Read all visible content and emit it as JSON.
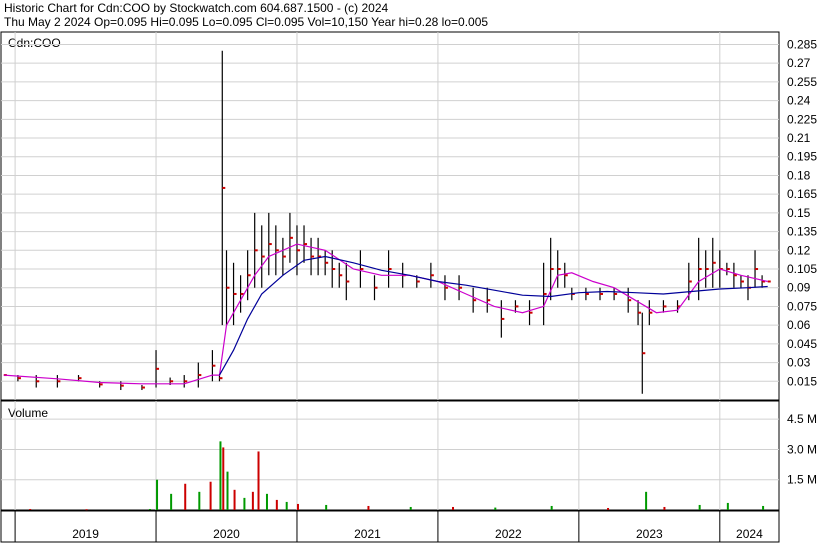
{
  "header": {
    "line1": "Historic Chart for Cdn:COO by Stockwatch.com 604.687.1500 - (c) 2024",
    "line2": "Thu May  2 2024   Op=0.095  Hi=0.095  Lo=0.095  Cl=0.095  Vol=10,150  Year hi=0.28  lo=0.005"
  },
  "chart_data": [
    {
      "type": "line",
      "subtype": "ohlc-bars",
      "label": "Cdn:COO",
      "y_ticks": [
        "0.285",
        "0.27",
        "0.255",
        "0.24",
        "0.225",
        "0.21",
        "0.195",
        "0.18",
        "0.165",
        "0.15",
        "0.135",
        "0.12",
        "0.105",
        "0.09",
        "0.075",
        "0.06",
        "0.045",
        "0.03",
        "0.015"
      ],
      "ylim": [
        0,
        0.295
      ],
      "xlim": [
        2018.9,
        2024.42
      ],
      "grid": true,
      "colors": {
        "price": "#000000",
        "close_tick": "#cc0000",
        "ma_short": "#cc00cc",
        "ma_long": "#000099"
      },
      "series": [
        {
          "kind": "price_range",
          "points": [
            [
              2018.92,
              0.02,
              0.02
            ],
            [
              2019.02,
              0.015,
              0.02
            ],
            [
              2019.15,
              0.01,
              0.02
            ],
            [
              2019.3,
              0.01,
              0.02
            ],
            [
              2019.45,
              0.015,
              0.02
            ],
            [
              2019.6,
              0.01,
              0.015
            ],
            [
              2019.75,
              0.008,
              0.015
            ],
            [
              2019.9,
              0.008,
              0.012
            ],
            [
              2020.0,
              0.01,
              0.04
            ],
            [
              2020.1,
              0.012,
              0.018
            ],
            [
              2020.2,
              0.01,
              0.02
            ],
            [
              2020.3,
              0.01,
              0.03
            ],
            [
              2020.4,
              0.015,
              0.04
            ],
            [
              2020.45,
              0.015,
              0.02
            ],
            [
              2020.47,
              0.06,
              0.28
            ],
            [
              2020.5,
              0.06,
              0.12
            ],
            [
              2020.55,
              0.06,
              0.11
            ],
            [
              2020.6,
              0.07,
              0.1
            ],
            [
              2020.65,
              0.08,
              0.12
            ],
            [
              2020.7,
              0.09,
              0.15
            ],
            [
              2020.75,
              0.09,
              0.14
            ],
            [
              2020.8,
              0.1,
              0.15
            ],
            [
              2020.85,
              0.1,
              0.14
            ],
            [
              2020.9,
              0.1,
              0.13
            ],
            [
              2020.95,
              0.11,
              0.15
            ],
            [
              2021.0,
              0.1,
              0.14
            ],
            [
              2021.05,
              0.11,
              0.14
            ],
            [
              2021.1,
              0.1,
              0.13
            ],
            [
              2021.15,
              0.1,
              0.13
            ],
            [
              2021.2,
              0.1,
              0.12
            ],
            [
              2021.25,
              0.09,
              0.12
            ],
            [
              2021.3,
              0.09,
              0.11
            ],
            [
              2021.35,
              0.08,
              0.11
            ],
            [
              2021.45,
              0.09,
              0.12
            ],
            [
              2021.55,
              0.08,
              0.1
            ],
            [
              2021.65,
              0.09,
              0.12
            ],
            [
              2021.75,
              0.09,
              0.11
            ],
            [
              2021.85,
              0.09,
              0.1
            ],
            [
              2021.95,
              0.09,
              0.11
            ],
            [
              2022.05,
              0.08,
              0.1
            ],
            [
              2022.15,
              0.08,
              0.1
            ],
            [
              2022.25,
              0.07,
              0.09
            ],
            [
              2022.35,
              0.07,
              0.09
            ],
            [
              2022.45,
              0.05,
              0.08
            ],
            [
              2022.55,
              0.07,
              0.08
            ],
            [
              2022.65,
              0.06,
              0.08
            ],
            [
              2022.75,
              0.06,
              0.11
            ],
            [
              2022.8,
              0.08,
              0.13
            ],
            [
              2022.85,
              0.09,
              0.12
            ],
            [
              2022.9,
              0.09,
              0.11
            ],
            [
              2022.95,
              0.08,
              0.09
            ],
            [
              2023.05,
              0.08,
              0.09
            ],
            [
              2023.15,
              0.08,
              0.09
            ],
            [
              2023.25,
              0.08,
              0.09
            ],
            [
              2023.35,
              0.07,
              0.09
            ],
            [
              2023.42,
              0.06,
              0.08
            ],
            [
              2023.45,
              0.005,
              0.07
            ],
            [
              2023.5,
              0.06,
              0.08
            ],
            [
              2023.6,
              0.07,
              0.08
            ],
            [
              2023.7,
              0.07,
              0.08
            ],
            [
              2023.78,
              0.08,
              0.11
            ],
            [
              2023.85,
              0.08,
              0.13
            ],
            [
              2023.9,
              0.09,
              0.12
            ],
            [
              2023.95,
              0.09,
              0.13
            ],
            [
              2024.0,
              0.09,
              0.12
            ],
            [
              2024.05,
              0.1,
              0.11
            ],
            [
              2024.1,
              0.09,
              0.11
            ],
            [
              2024.15,
              0.09,
              0.1
            ],
            [
              2024.2,
              0.08,
              0.1
            ],
            [
              2024.25,
              0.09,
              0.12
            ],
            [
              2024.3,
              0.09,
              0.1
            ],
            [
              2024.34,
              0.095,
              0.095
            ]
          ]
        },
        {
          "name": "",
          "kind": "moving_average_short",
          "points": [
            [
              2018.92,
              0.02
            ],
            [
              2019.3,
              0.017
            ],
            [
              2019.6,
              0.014
            ],
            [
              2019.9,
              0.013
            ],
            [
              2020.2,
              0.013
            ],
            [
              2020.4,
              0.02
            ],
            [
              2020.45,
              0.02
            ],
            [
              2020.5,
              0.06
            ],
            [
              2020.6,
              0.08
            ],
            [
              2020.7,
              0.1
            ],
            [
              2020.8,
              0.115
            ],
            [
              2021.0,
              0.125
            ],
            [
              2021.2,
              0.12
            ],
            [
              2021.4,
              0.105
            ],
            [
              2021.6,
              0.1
            ],
            [
              2021.8,
              0.1
            ],
            [
              2022.0,
              0.095
            ],
            [
              2022.2,
              0.085
            ],
            [
              2022.4,
              0.075
            ],
            [
              2022.6,
              0.07
            ],
            [
              2022.75,
              0.075
            ],
            [
              2022.85,
              0.1
            ],
            [
              2022.95,
              0.102
            ],
            [
              2023.1,
              0.095
            ],
            [
              2023.25,
              0.09
            ],
            [
              2023.4,
              0.08
            ],
            [
              2023.55,
              0.07
            ],
            [
              2023.7,
              0.072
            ],
            [
              2023.85,
              0.095
            ],
            [
              2024.0,
              0.105
            ],
            [
              2024.15,
              0.1
            ],
            [
              2024.34,
              0.095
            ]
          ]
        },
        {
          "name": "",
          "kind": "moving_average_long",
          "points": [
            [
              2020.45,
              0.02
            ],
            [
              2020.55,
              0.04
            ],
            [
              2020.65,
              0.065
            ],
            [
              2020.75,
              0.085
            ],
            [
              2020.9,
              0.1
            ],
            [
              2021.05,
              0.112
            ],
            [
              2021.2,
              0.115
            ],
            [
              2021.4,
              0.11
            ],
            [
              2021.6,
              0.104
            ],
            [
              2021.8,
              0.1
            ],
            [
              2022.0,
              0.095
            ],
            [
              2022.2,
              0.092
            ],
            [
              2022.4,
              0.088
            ],
            [
              2022.6,
              0.084
            ],
            [
              2022.8,
              0.083
            ],
            [
              2023.0,
              0.086
            ],
            [
              2023.2,
              0.087
            ],
            [
              2023.4,
              0.086
            ],
            [
              2023.6,
              0.085
            ],
            [
              2023.8,
              0.087
            ],
            [
              2024.0,
              0.089
            ],
            [
              2024.2,
              0.09
            ],
            [
              2024.34,
              0.091
            ]
          ]
        }
      ]
    },
    {
      "type": "bar",
      "label": "Volume",
      "y_ticks": [
        "4.5 M",
        "3.0 M",
        "1.5 M"
      ],
      "ylim": [
        0,
        5.4
      ],
      "x_ticks": [
        "2019",
        "2020",
        "2021",
        "2022",
        "2023",
        "2024"
      ],
      "grid": true,
      "colors": {
        "up": "#009900",
        "down": "#cc0000"
      },
      "bars": [
        [
          2019.1,
          0.05,
          "down"
        ],
        [
          2019.5,
          0.04,
          "down"
        ],
        [
          2019.95,
          0.05,
          "up"
        ],
        [
          2020.0,
          1.5,
          "up"
        ],
        [
          2020.1,
          0.8,
          "up"
        ],
        [
          2020.2,
          1.3,
          "down"
        ],
        [
          2020.3,
          0.9,
          "up"
        ],
        [
          2020.38,
          1.4,
          "down"
        ],
        [
          2020.45,
          3.4,
          "up"
        ],
        [
          2020.47,
          3.1,
          "down"
        ],
        [
          2020.5,
          1.9,
          "up"
        ],
        [
          2020.55,
          1.0,
          "down"
        ],
        [
          2020.62,
          0.6,
          "up"
        ],
        [
          2020.68,
          0.9,
          "down"
        ],
        [
          2020.72,
          2.9,
          "down"
        ],
        [
          2020.78,
          0.8,
          "up"
        ],
        [
          2020.85,
          0.5,
          "down"
        ],
        [
          2020.92,
          0.4,
          "up"
        ],
        [
          2021.0,
          0.3,
          "down"
        ],
        [
          2021.2,
          0.25,
          "up"
        ],
        [
          2021.5,
          0.2,
          "down"
        ],
        [
          2021.8,
          0.15,
          "up"
        ],
        [
          2022.1,
          0.15,
          "down"
        ],
        [
          2022.4,
          0.12,
          "up"
        ],
        [
          2022.8,
          0.2,
          "up"
        ],
        [
          2023.2,
          0.1,
          "down"
        ],
        [
          2023.47,
          0.9,
          "up"
        ],
        [
          2023.6,
          0.15,
          "down"
        ],
        [
          2023.85,
          0.25,
          "up"
        ],
        [
          2024.05,
          0.35,
          "up"
        ],
        [
          2024.3,
          0.2,
          "up"
        ]
      ]
    }
  ]
}
